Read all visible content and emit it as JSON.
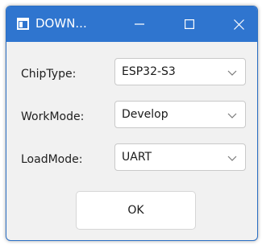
{
  "window": {
    "title": "DOWN...",
    "accent_color": "#2f75cf",
    "icons": {
      "app": "app-window-icon",
      "minimize": "minimize-icon",
      "maximize": "maximize-icon",
      "close": "close-icon"
    }
  },
  "form": {
    "rows": [
      {
        "label": "ChipType:",
        "value": "ESP32-S3"
      },
      {
        "label": "WorkMode:",
        "value": "Develop"
      },
      {
        "label": "LoadMode:",
        "value": "UART"
      }
    ],
    "ok_label": "OK"
  }
}
